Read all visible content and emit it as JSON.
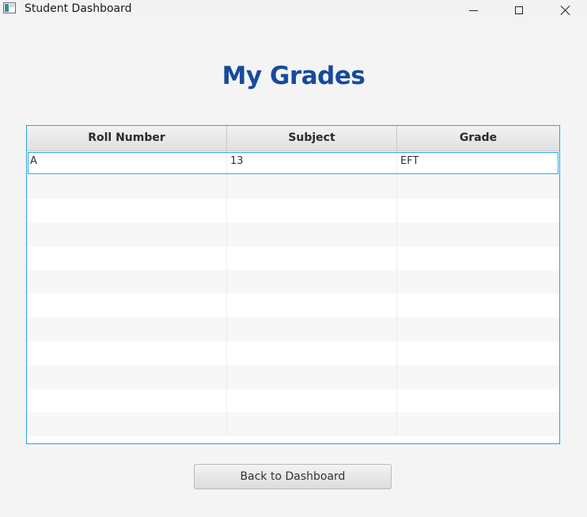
{
  "window": {
    "title": "Student Dashboard"
  },
  "page": {
    "title": "My Grades"
  },
  "grades_table": {
    "columns": [
      "Roll Number",
      "Subject",
      "Grade"
    ],
    "rows": [
      {
        "roll_number": "A",
        "subject": "13",
        "grade": "EFT"
      }
    ],
    "empty_row_count": 11
  },
  "actions": {
    "back_label": "Back to Dashboard"
  },
  "colors": {
    "title": "#174a9c",
    "table_border": "#2aa7d9"
  }
}
